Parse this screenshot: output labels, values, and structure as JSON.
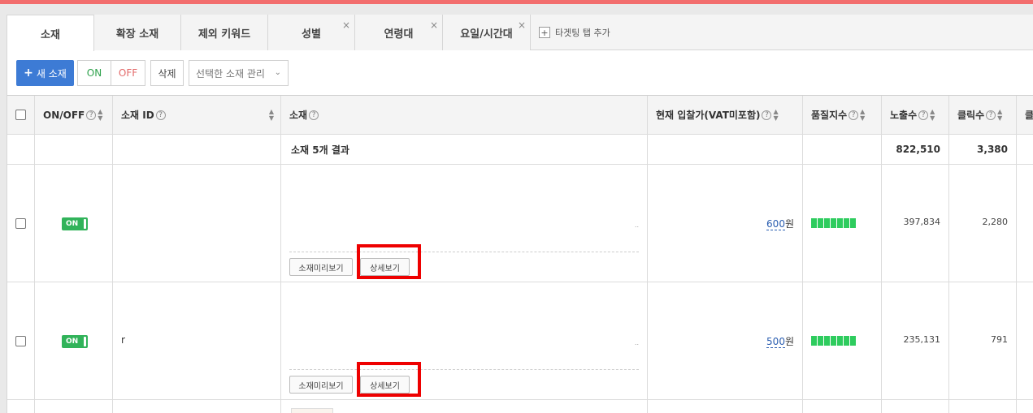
{
  "tabs": [
    {
      "label": "소재",
      "active": true,
      "closable": false
    },
    {
      "label": "확장 소재",
      "active": false,
      "closable": false
    },
    {
      "label": "제외 키워드",
      "active": false,
      "closable": false
    },
    {
      "label": "성별",
      "active": false,
      "closable": true
    },
    {
      "label": "연령대",
      "active": false,
      "closable": true
    },
    {
      "label": "요일/시간대",
      "active": false,
      "closable": true
    }
  ],
  "add_tab": {
    "icon": "plus",
    "label": "타겟팅 탭 추가"
  },
  "toolbar": {
    "new_label": "새 소재",
    "on_label": "ON",
    "off_label": "OFF",
    "delete_label": "삭제",
    "manage_select": "선택한 소재 관리"
  },
  "columns": {
    "onoff": "ON/OFF",
    "id": "소재 ID",
    "creative": "소재",
    "bid": "현재 입찰가(VAT미포함)",
    "quality": "품질지수",
    "impressions": "노출수",
    "clicks": "클릭수",
    "more": "클"
  },
  "summary": {
    "label": "소재 5개 결과",
    "impressions": "822,510",
    "clicks": "3,380"
  },
  "rows": [
    {
      "status": "ON",
      "id": "",
      "preview_btn": "소재미리보기",
      "detail_btn": "상세보기",
      "bid_value": "600",
      "bid_unit": "원",
      "quality_level": 7,
      "impressions": "397,834",
      "clicks": "2,280"
    },
    {
      "status": "ON",
      "id": "r",
      "preview_btn": "소재미리보기",
      "detail_btn": "상세보기",
      "bid_value": "500",
      "bid_unit": "원",
      "quality_level": 7,
      "impressions": "235,131",
      "clicks": "791"
    }
  ],
  "colors": {
    "accent": "#3d7bd5",
    "on": "#31b35a",
    "highlight": "#ee0000",
    "topbar": "#f26d6d"
  }
}
